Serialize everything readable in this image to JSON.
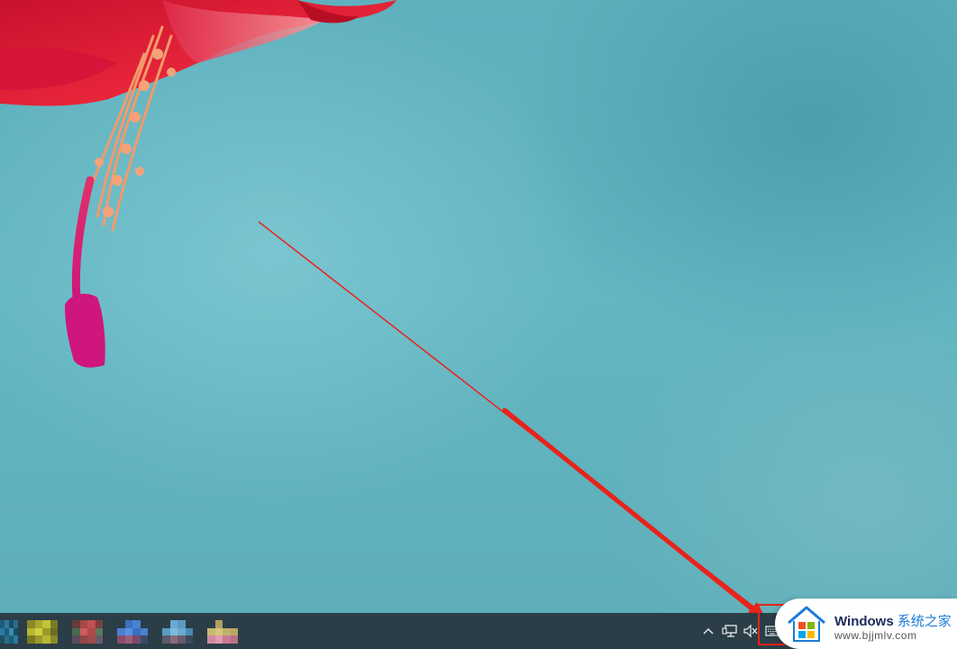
{
  "desktop": {
    "wallpaper": "pink flower on teal background",
    "colors": {
      "background": "#62b3bf",
      "flower_red": "#e8263a",
      "flower_pink": "#d6157a",
      "stamen": "#f29a6a"
    }
  },
  "annotation": {
    "arrow_color": "#e8231b",
    "highlight_target": "input-indicator-icon"
  },
  "taskbar": {
    "background": "#2b3e47",
    "apps": [
      {
        "name": "pinned-app-1"
      },
      {
        "name": "pinned-app-2"
      },
      {
        "name": "pinned-app-3"
      },
      {
        "name": "pinned-app-4"
      },
      {
        "name": "pinned-app-5"
      },
      {
        "name": "pinned-app-6"
      }
    ],
    "tray": {
      "chevron_icon": "chevron-up-icon",
      "network_icon": "network-icon",
      "volume_icon": "volume-muted-icon",
      "input_icon": "keyboard-icon"
    }
  },
  "watermark": {
    "brand": "Windows",
    "brand_cn": "系统之家",
    "url": "www.bjjmlv.com"
  }
}
